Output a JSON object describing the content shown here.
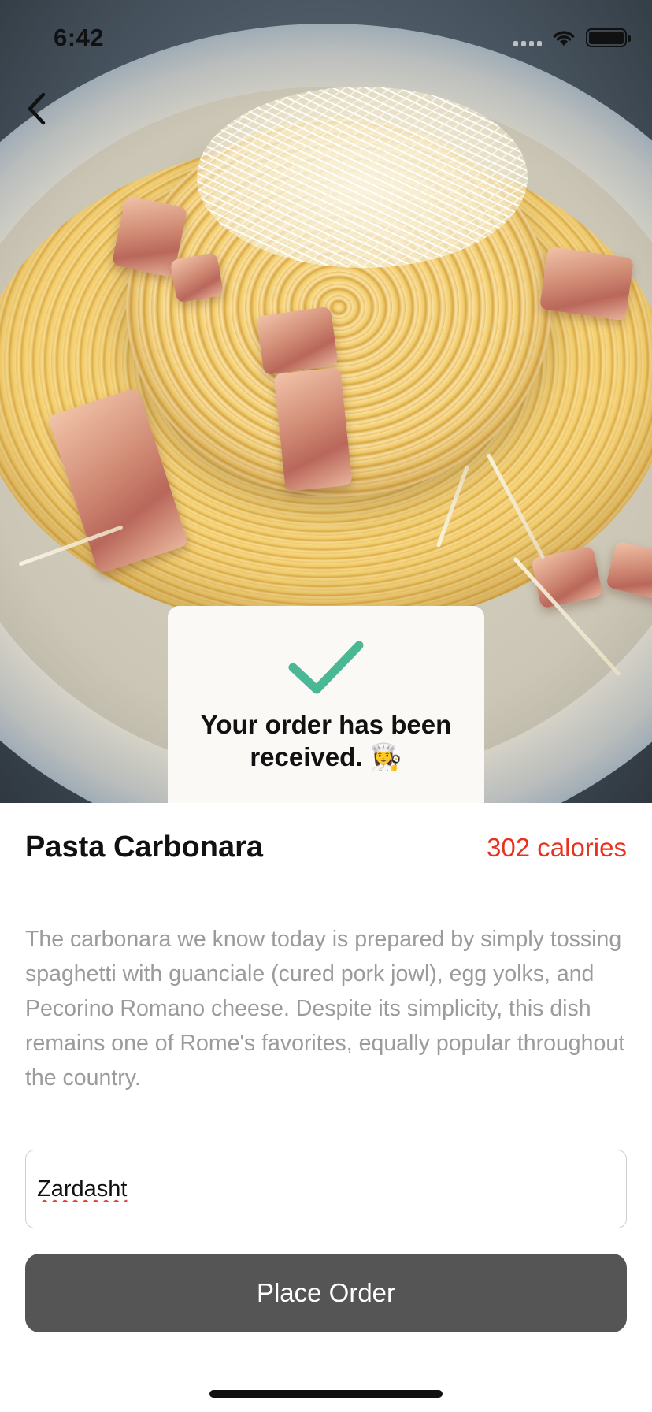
{
  "status_bar": {
    "time": "6:42"
  },
  "navigation": {
    "back_icon": "chevron-left-icon"
  },
  "hero": {
    "image": "pasta carbonara photo"
  },
  "toast": {
    "icon": "checkmark-icon",
    "message": "Your order has been received. 👩‍🍳",
    "check_color": "#4ab795"
  },
  "dish": {
    "title": "Pasta Carbonara",
    "calories": "302 calories",
    "calories_color": "#e8321e",
    "description": "The carbonara we know today is prepared by simply tossing spaghetti with guanciale (cured pork jowl), egg yolks, and Pecorino Romano cheese. Despite its simplicity, this dish remains one of Rome's favorites, equally popular throughout the country."
  },
  "order_form": {
    "name_value": "Zardasht",
    "button_label": "Place Order"
  }
}
